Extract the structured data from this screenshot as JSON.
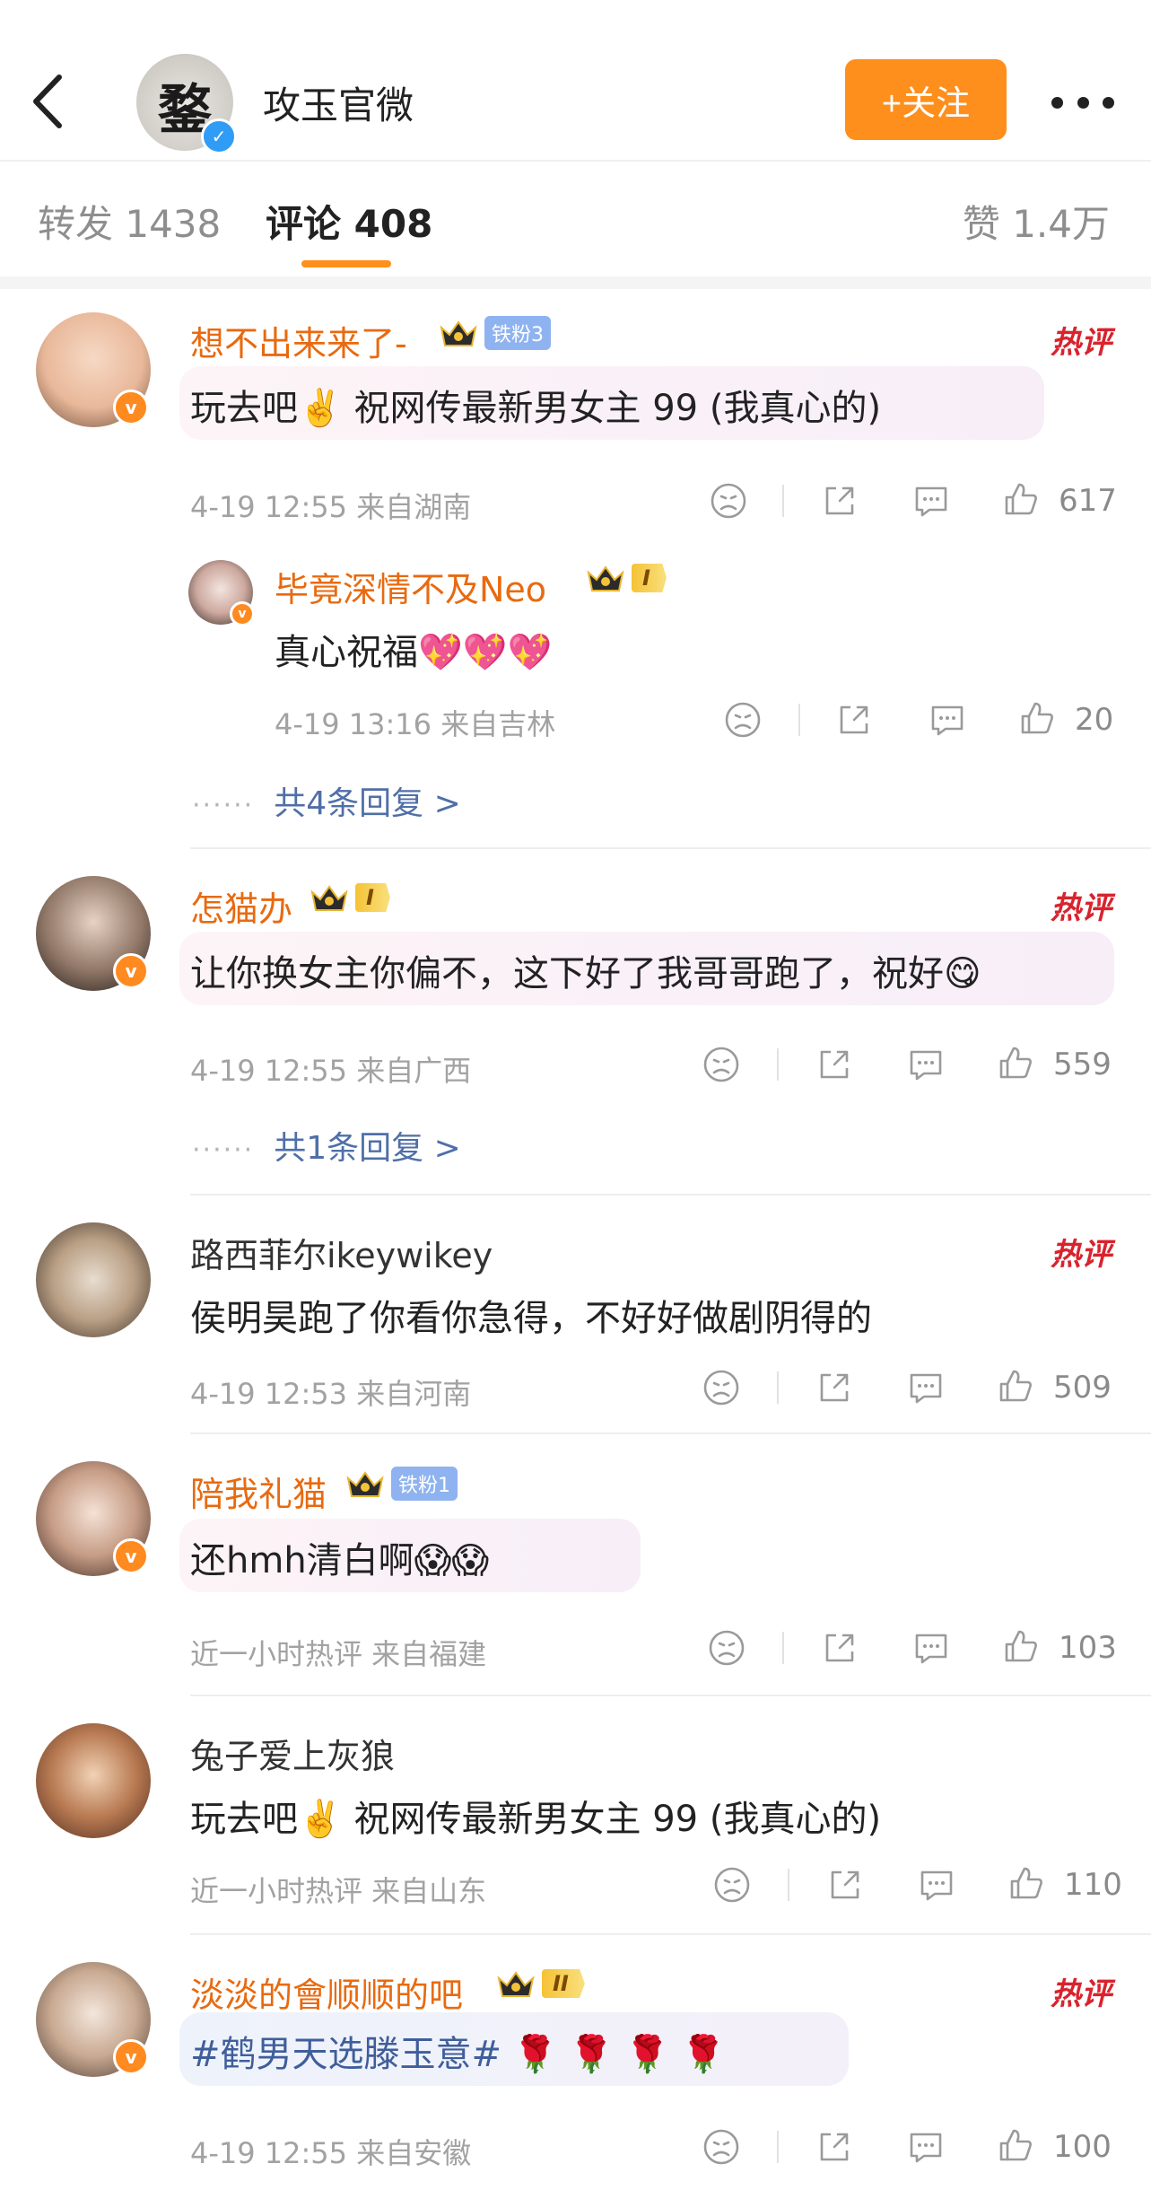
{
  "header": {
    "account_name": "攻玉官微",
    "avatar_glyph": "鍪",
    "follow_label": "+关注"
  },
  "tabs": {
    "repost": "转发 1438",
    "comments": "评论 408",
    "likes": "赞 1.4万"
  },
  "hot_label": "热评",
  "colors": {
    "accent": "#ff8f1c",
    "name_vip": "#e86a10",
    "link": "#506fa8",
    "hot": "#d9232d"
  },
  "comments": [
    {
      "name": "想不出来来了-",
      "fan_badge": "铁粉3",
      "text": "玩去吧✌️ 祝网传最新男女主 99 (我真心的)",
      "meta": "4-19 12:55  来自湖南",
      "likes": "617",
      "reply": {
        "name": "毕竟深情不及Neo",
        "level": "I",
        "text": "真心祝福💖💖💖",
        "meta": "4-19 13:16  来自吉林",
        "likes": "20"
      },
      "more_replies": "共4条回复 >"
    },
    {
      "name": "怎猫办",
      "level": "I",
      "text": "让你换女主你偏不，这下好了我哥哥跑了，祝好😋",
      "meta": "4-19 12:55  来自广西",
      "likes": "559",
      "more_replies": "共1条回复 >"
    },
    {
      "name": "路西菲尔ikeywikey",
      "text": "侯明昊跑了你看你急得，不好好做剧阴得的",
      "meta": "4-19 12:53  来自河南",
      "likes": "509"
    },
    {
      "name": "陪我礼猫",
      "fan_badge": "铁粉1",
      "text": "还hmh清白啊😱😱",
      "meta": "近一小时热评  来自福建",
      "likes": "103"
    },
    {
      "name": "兔子爱上灰狼",
      "text": "玩去吧✌️ 祝网传最新男女主 99 (我真心的)",
      "meta": "近一小时热评  来自山东",
      "likes": "110"
    },
    {
      "name": "淡淡的會顺顺的吧",
      "level": "II",
      "text": "#鹤男天选滕玉意# 🌹 🌹 🌹 🌹",
      "meta": "4-19 12:55  来自安徽",
      "likes": "100"
    }
  ]
}
